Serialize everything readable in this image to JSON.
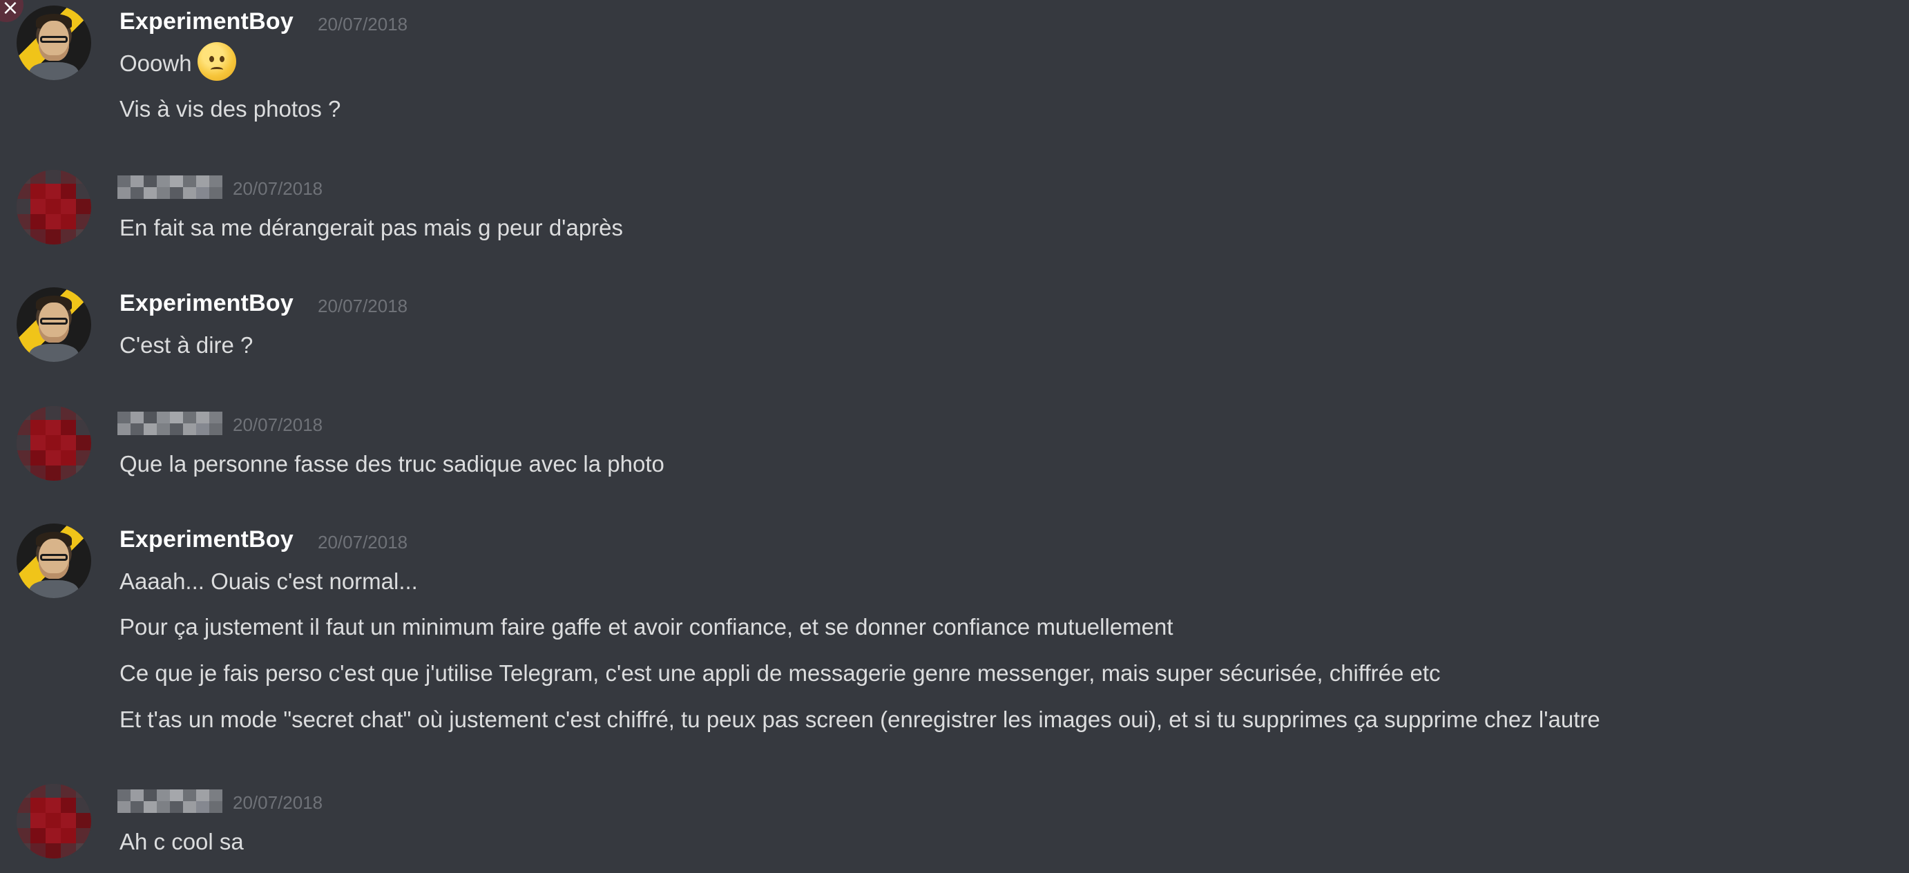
{
  "messages": [
    {
      "author": "ExperimentBoy",
      "author_hidden": false,
      "timestamp": "20/07/2018",
      "lines": [
        "Ooowh",
        "Vis à vis des photos ?"
      ],
      "emoji": "frowning-face-icon"
    },
    {
      "author": "",
      "author_hidden": true,
      "timestamp": "20/07/2018",
      "lines": [
        "En fait sa me dérangerait pas mais g peur d'après"
      ]
    },
    {
      "author": "ExperimentBoy",
      "author_hidden": false,
      "timestamp": "20/07/2018",
      "lines": [
        "C'est à dire ?"
      ]
    },
    {
      "author": "",
      "author_hidden": true,
      "timestamp": "20/07/2018",
      "lines": [
        "Que la personne fasse des truc sadique avec la photo"
      ]
    },
    {
      "author": "ExperimentBoy",
      "author_hidden": false,
      "timestamp": "20/07/2018",
      "lines": [
        "Aaaah... Ouais c'est normal...",
        "Pour ça justement il faut un minimum faire gaffe et avoir confiance, et se donner confiance mutuellement",
        "Ce que je fais perso c'est que j'utilise Telegram, c'est une appli de messagerie genre messenger, mais super sécurisée, chiffrée etc",
        "Et t'as un mode \"secret chat\" où justement c'est chiffré, tu peux pas screen (enregistrer les images oui), et si tu supprimes ça supprime chez l'autre"
      ]
    },
    {
      "author": "",
      "author_hidden": true,
      "timestamp": "20/07/2018",
      "lines": [
        "Ah c cool sa"
      ]
    }
  ],
  "colors": {
    "background": "#36393f",
    "text": "#dcddde",
    "username": "#ffffff",
    "timestamp": "#6f7278",
    "close_badge": "#5b2f3c"
  },
  "icons": {
    "close": "×"
  }
}
